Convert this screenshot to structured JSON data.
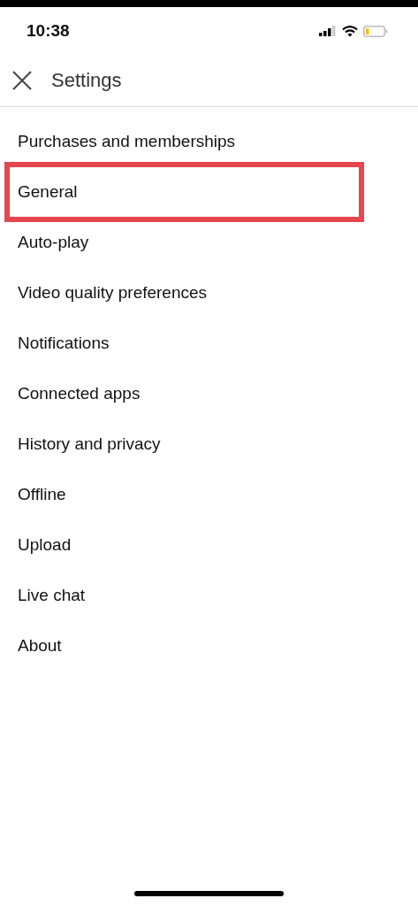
{
  "status_bar": {
    "time": "10:38"
  },
  "header": {
    "title": "Settings"
  },
  "items": [
    {
      "label": "Purchases and memberships",
      "highlighted": false
    },
    {
      "label": "General",
      "highlighted": true
    },
    {
      "label": "Auto-play",
      "highlighted": false
    },
    {
      "label": "Video quality preferences",
      "highlighted": false
    },
    {
      "label": "Notifications",
      "highlighted": false
    },
    {
      "label": "Connected apps",
      "highlighted": false
    },
    {
      "label": "History and privacy",
      "highlighted": false
    },
    {
      "label": "Offline",
      "highlighted": false
    },
    {
      "label": "Upload",
      "highlighted": false
    },
    {
      "label": "Live chat",
      "highlighted": false
    },
    {
      "label": "About",
      "highlighted": false
    }
  ]
}
